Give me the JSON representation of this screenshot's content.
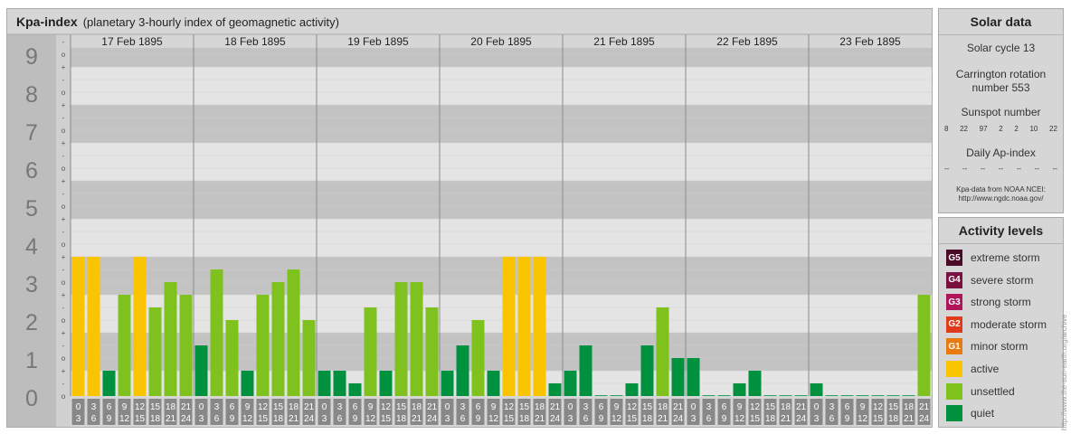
{
  "header": {
    "title": "Kpa-index",
    "subtitle": "(planetary 3-hourly index of geomagnetic activity)"
  },
  "solar": {
    "title": "Solar data",
    "cycle": "Solar cycle 13",
    "carrington_line1": "Carrington rotation",
    "carrington_line2": "number 553",
    "sunspot_title": "Sunspot number",
    "sunspots": [
      "8",
      "22",
      "97",
      "2",
      "2",
      "10",
      "22"
    ],
    "ap_title": "Daily Ap-index",
    "ap_values": [
      "--",
      "--",
      "--",
      "--",
      "--",
      "--",
      "--"
    ],
    "source_line1": "Kpa-data from NOAA NCEI:",
    "source_line2": "http://www.ngdc.noaa.gov/"
  },
  "levels": {
    "title": "Activity levels",
    "items": [
      {
        "code": "G5",
        "label": "extreme storm",
        "color": "#4b0a25"
      },
      {
        "code": "G4",
        "label": "severe storm",
        "color": "#7a1040"
      },
      {
        "code": "G3",
        "label": "strong storm",
        "color": "#b0155a"
      },
      {
        "code": "G2",
        "label": "moderate storm",
        "color": "#e03a1a"
      },
      {
        "code": "G1",
        "label": "minor storm",
        "color": "#e87a10"
      },
      {
        "code": "",
        "label": "active",
        "color": "#fac400"
      },
      {
        "code": "",
        "label": "unsettled",
        "color": "#7fc21e"
      },
      {
        "code": "",
        "label": "quiet",
        "color": "#00913f"
      }
    ]
  },
  "credit": "http://www.the-sun-earth.org/archive",
  "chart_data": {
    "type": "bar",
    "y_tick_labels": [
      "0",
      "1",
      "2",
      "3",
      "4",
      "5",
      "6",
      "7",
      "8",
      "9"
    ],
    "sub_tick_labels": [
      "+",
      "o",
      "-"
    ],
    "ylim": [
      0,
      9.333
    ],
    "days": [
      "17 Feb 1895",
      "18 Feb 1895",
      "19 Feb 1895",
      "20 Feb 1895",
      "21 Feb 1895",
      "22 Feb 1895",
      "23 Feb 1895"
    ],
    "interval_top": [
      "0",
      "3",
      "6",
      "9",
      "12",
      "15",
      "18",
      "21"
    ],
    "interval_bottom": [
      "3",
      "6",
      "9",
      "12",
      "15",
      "18",
      "21",
      "24"
    ],
    "values": [
      [
        3.667,
        3.667,
        0.667,
        2.667,
        3.667,
        2.333,
        3.0,
        2.667
      ],
      [
        1.333,
        3.333,
        2.0,
        0.667,
        2.667,
        3.0,
        3.333,
        2.0
      ],
      [
        0.667,
        0.667,
        0.333,
        2.333,
        0.667,
        3.0,
        3.0,
        2.333
      ],
      [
        0.667,
        1.333,
        2.0,
        0.667,
        3.667,
        3.667,
        3.667,
        0.333
      ],
      [
        0.667,
        1.333,
        0.0,
        0.0,
        0.333,
        1.333,
        2.333,
        1.0
      ],
      [
        1.0,
        0.0,
        0.0,
        0.333,
        0.667,
        0.0,
        0.0,
        0.0
      ],
      [
        0.333,
        0.0,
        0.0,
        0.0,
        0.0,
        0.0,
        0.0,
        2.667
      ]
    ],
    "thresholds": {
      "quiet_below": 2.0,
      "unsettled_below": 3.5,
      "active_below": 4.5
    },
    "colors": {
      "quiet": "#00913f",
      "unsettled": "#7fc21e",
      "active": "#fac400",
      "band_dark": "#c3c3c3",
      "band_light": "#e4e4e4",
      "grid": "#cfcfcf",
      "axis_bg": "#bdbdbd",
      "tick_text": "#777777",
      "label_box": "#888888"
    }
  }
}
